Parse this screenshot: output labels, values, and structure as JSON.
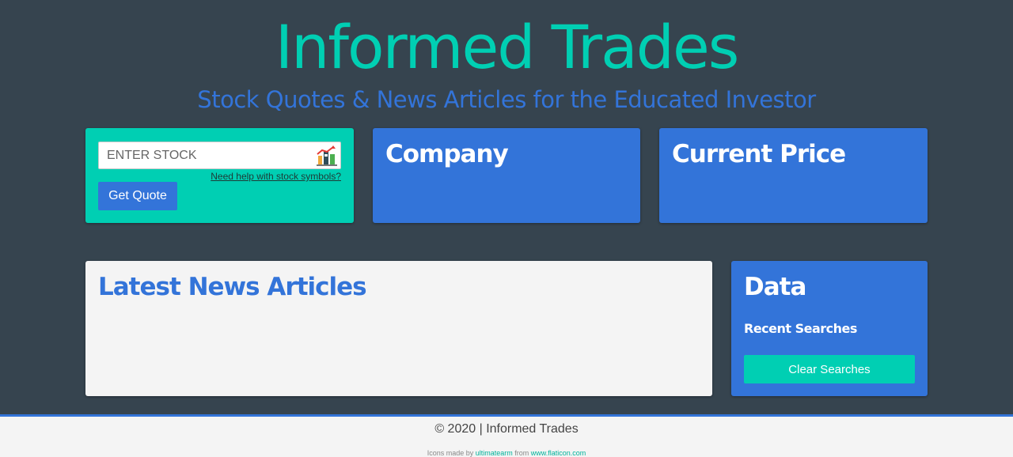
{
  "header": {
    "title": "Informed Trades",
    "subtitle": "Stock Quotes & News Articles for the Educated Investor"
  },
  "search": {
    "placeholder": "ENTER STOCK",
    "value": "",
    "help_link": "Need help with stock symbols?",
    "button_label": "Get Quote",
    "icon": "stock-chart-icon"
  },
  "company": {
    "heading": "Company"
  },
  "price": {
    "heading": "Current Price"
  },
  "news": {
    "heading": "Latest News Articles"
  },
  "data_panel": {
    "heading": "Data",
    "recent_heading": "Recent Searches",
    "clear_button": "Clear Searches"
  },
  "footer": {
    "copyright": "© 2020 | Informed Trades",
    "attribution_prefix": "Icons made by",
    "attribution_author": "ultimatearm",
    "attribution_mid": "from",
    "attribution_site": "www.flaticon.com"
  },
  "colors": {
    "background": "#36444f",
    "teal": "#00cfb3",
    "blue": "#3374d9",
    "panel_light": "#f4f4f4"
  }
}
